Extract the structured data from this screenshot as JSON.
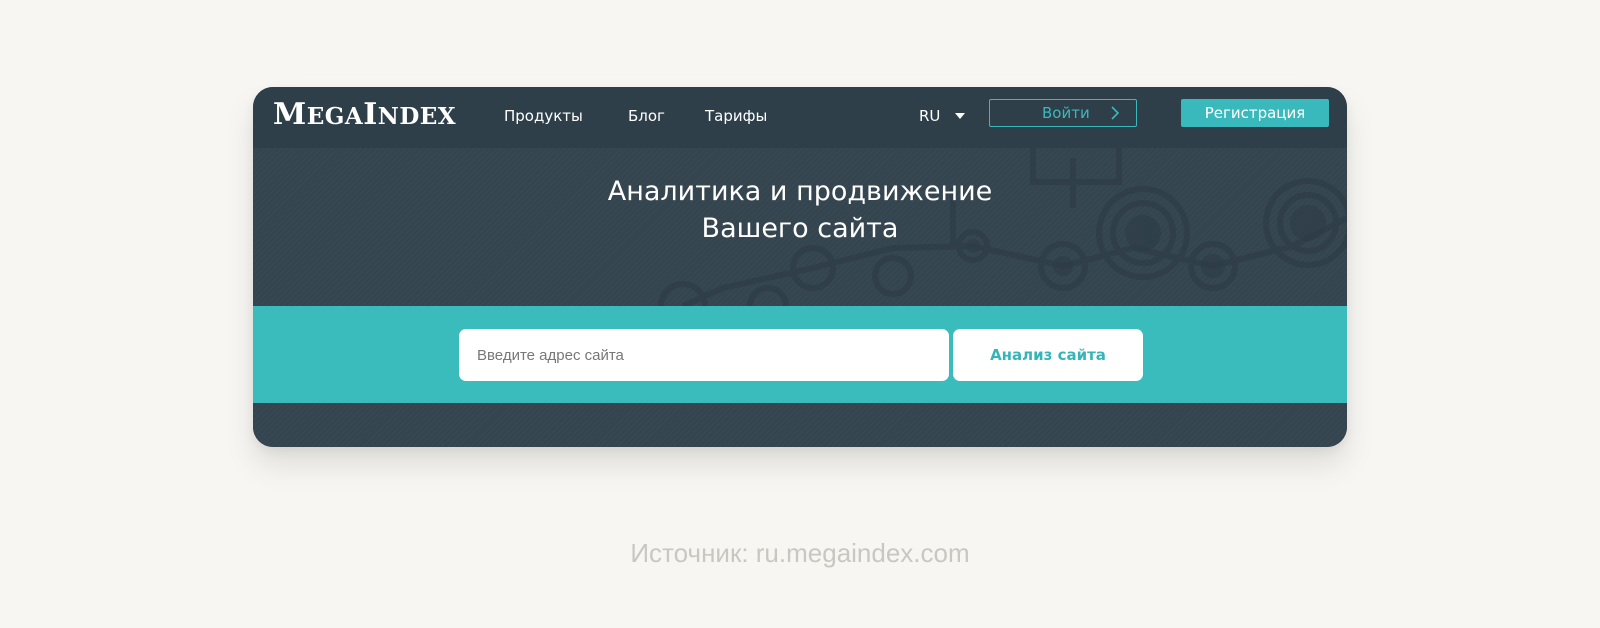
{
  "header": {
    "logo": {
      "first_big": "M",
      "first_rest": "EGA",
      "second_big": "I",
      "second_rest": "NDEX"
    },
    "nav": [
      {
        "label": "Продукты"
      },
      {
        "label": "Блог"
      },
      {
        "label": "Тарифы"
      }
    ],
    "language": "RU",
    "login_label": "Войти",
    "register_label": "Регистрация"
  },
  "hero": {
    "title_line1": "Аналитика и продвижение",
    "title_line2": "Вашего сайта"
  },
  "search": {
    "placeholder": "Введите адрес сайта",
    "value": "",
    "button_label": "Анализ сайта"
  },
  "caption": "Источник: ru.megaindex.com",
  "colors": {
    "page_background": "#f7f6f2",
    "header_dark": "#2e3f4a",
    "hero_dark": "#34454f",
    "accent_teal": "#3ab9bd",
    "caption_gray": "#c9c7c2"
  },
  "icons": {
    "language_dropdown": "caret-down-icon",
    "login_arrow": "chevron-right-icon"
  }
}
